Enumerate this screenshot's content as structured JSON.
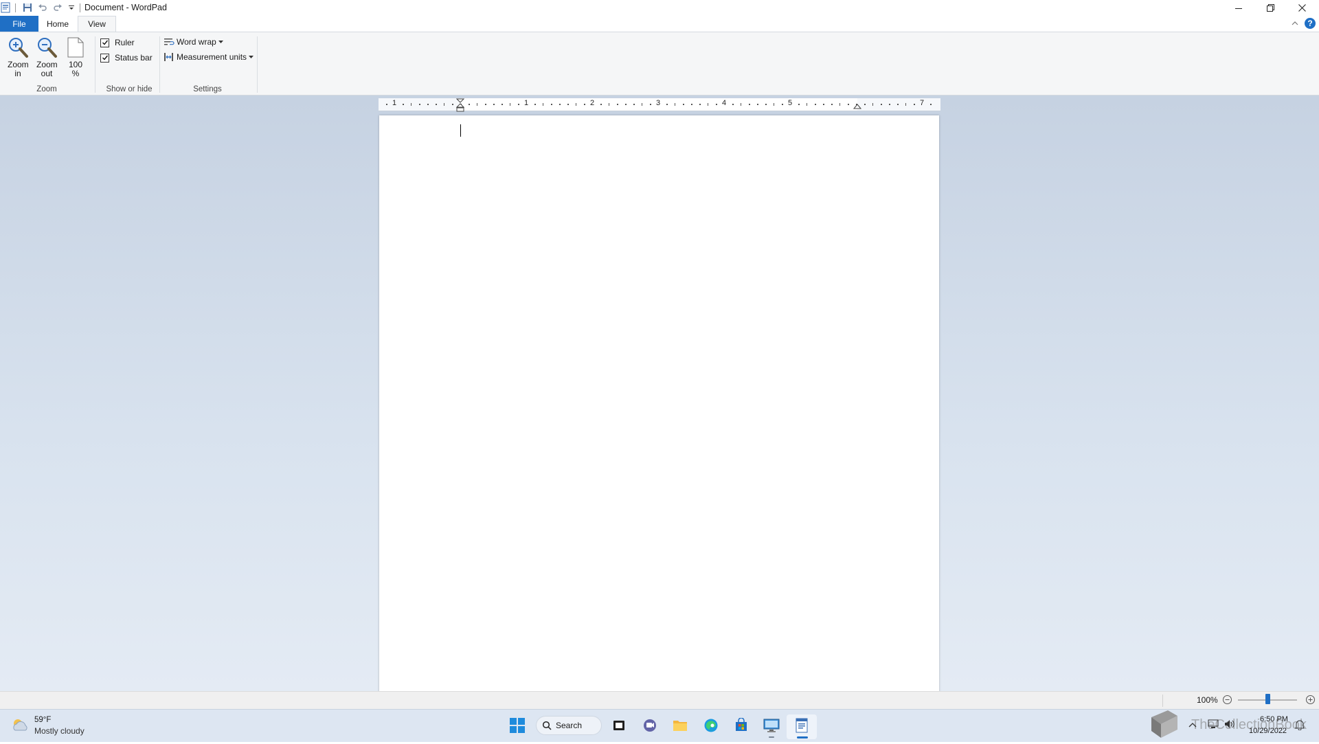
{
  "window": {
    "title": "Document - WordPad"
  },
  "tabs": {
    "file": "File",
    "home": "Home",
    "view": "View"
  },
  "ribbon": {
    "zoom": {
      "zoom_in": "Zoom in",
      "zoom_out": "Zoom out",
      "hundred": "100 %",
      "group_label": "Zoom"
    },
    "show_hide": {
      "ruler": "Ruler",
      "status_bar": "Status bar",
      "ruler_checked": true,
      "status_bar_checked": true,
      "group_label": "Show or hide"
    },
    "settings": {
      "word_wrap": "Word wrap",
      "measurement_units": "Measurement units",
      "group_label": "Settings"
    }
  },
  "ruler": {
    "numbers": [
      "1",
      "1",
      "2",
      "3",
      "4",
      "5",
      "7"
    ]
  },
  "statusbar": {
    "zoom": "100%"
  },
  "taskbar": {
    "weather_temp": "59°F",
    "weather_desc": "Mostly cloudy",
    "search": "Search",
    "time": "6:50 PM",
    "date": "10/29/2022"
  },
  "watermark": "TheCollectionBook",
  "colors": {
    "accent": "#1f6fc5",
    "workspace": "#d3ddea",
    "taskbar": "#dde6f2"
  }
}
